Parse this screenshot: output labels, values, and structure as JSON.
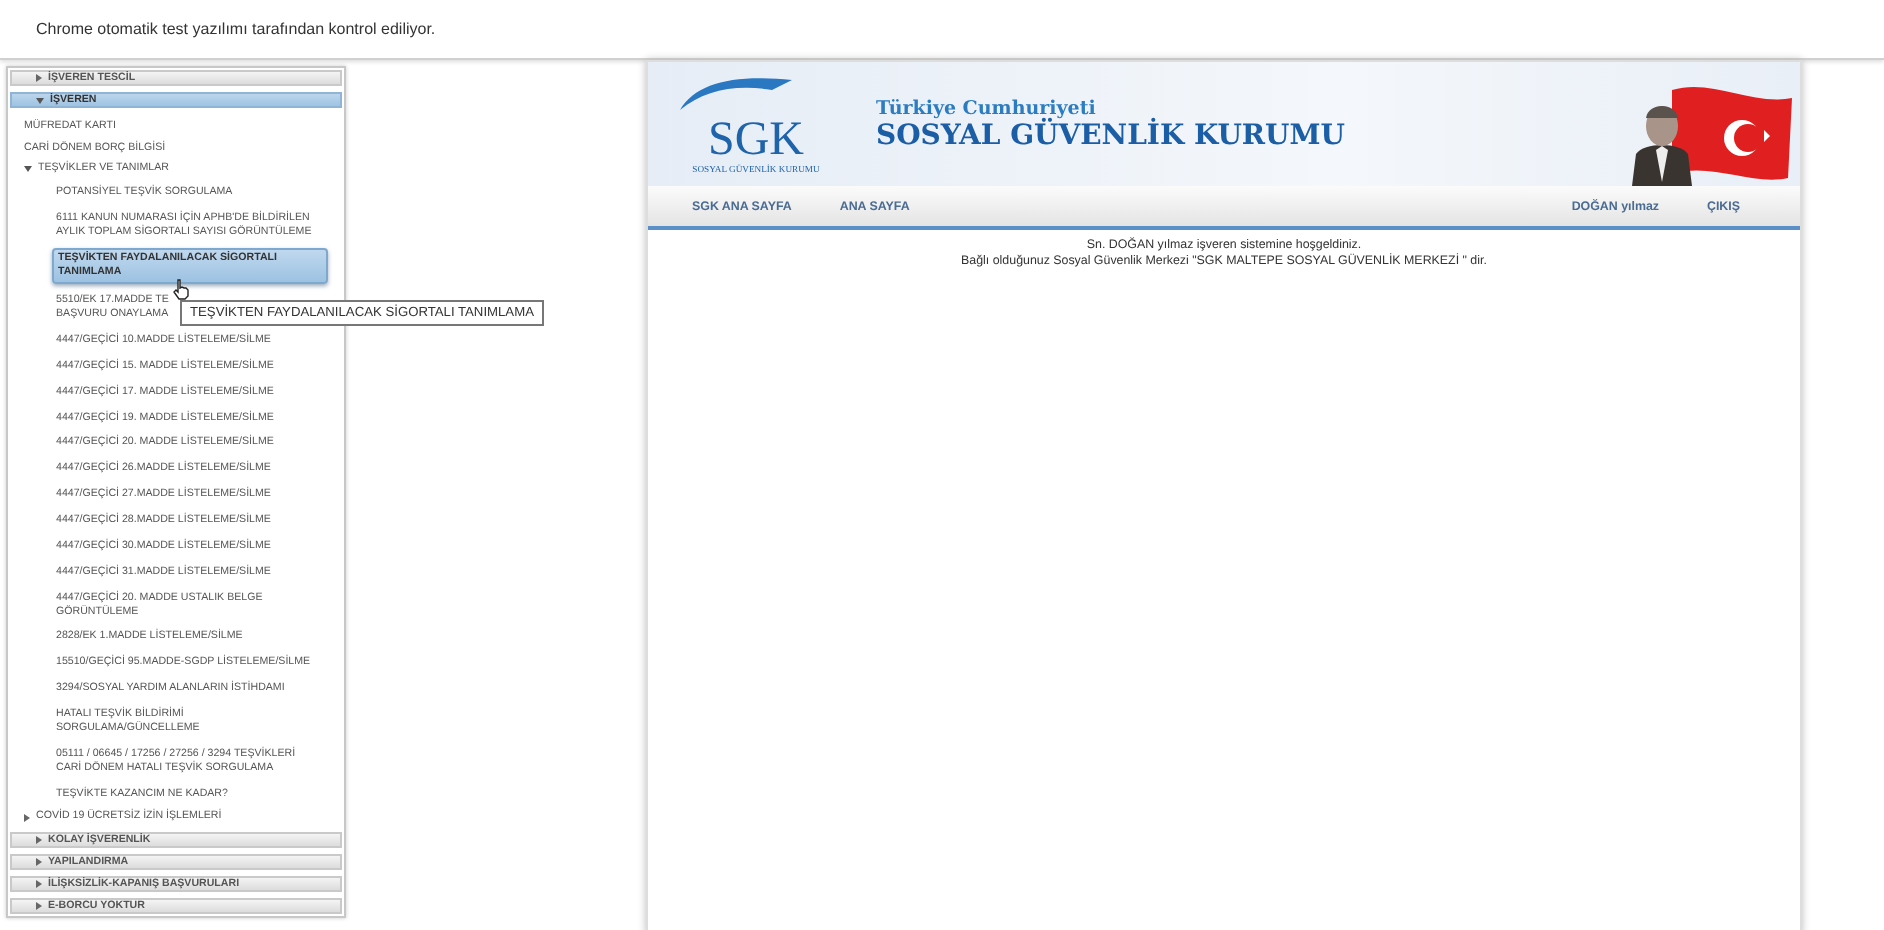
{
  "banner": "Chrome otomatik test yazılımı tarafından kontrol ediliyor.",
  "sidebar": {
    "panels": [
      {
        "title": "İŞVEREN TESCİL",
        "expanded": false
      },
      {
        "title": "İŞVEREN",
        "expanded": true,
        "items": [
          {
            "kind": "link",
            "label": "MÜFREDAT KARTI",
            "selected": false
          },
          {
            "kind": "link",
            "label": "CARİ DÖNEM BORÇ BİLGİSİ",
            "selected": false
          },
          {
            "kind": "folder",
            "label": "TEŞVİKLER VE TANIMLAR",
            "expanded": true,
            "selected": false,
            "children": [
              {
                "label": "POTANSİYEL TEŞVİK SORGULAMA",
                "selected": false
              },
              {
                "label": "6111 KANUN NUMARASI İÇİN APHB'DE BİLDİRİLEN AYLIK TOPLAM SİGORTALI SAYISI GÖRÜNTÜLEME",
                "selected": false
              },
              {
                "label": "TEŞVİKTEN FAYDALANILACAK SİGORTALI TANIMLAMA",
                "selected": true
              },
              {
                "label": "5510/EK 17.MADDE TE\nBAŞVURU ONAYLAMA",
                "selected": false
              },
              {
                "label": "4447/GEÇİCİ 10.MADDE LİSTELEME/SİLME",
                "selected": false
              },
              {
                "label": "4447/GEÇİCİ 15. MADDE LİSTELEME/SİLME",
                "selected": false
              },
              {
                "label": "4447/GEÇİCİ 17. MADDE LİSTELEME/SİLME",
                "selected": false
              },
              {
                "label": "4447/GEÇİCİ 19. MADDE LİSTELEME/SİLME",
                "selected": false
              },
              {
                "label": "4447/GEÇİCİ 20. MADDE LİSTELEME/SİLME",
                "selected": false
              },
              {
                "label": "4447/GEÇİCİ 26.MADDE LİSTELEME/SİLME",
                "selected": false
              },
              {
                "label": "4447/GEÇİCİ 27.MADDE LİSTELEME/SİLME",
                "selected": false
              },
              {
                "label": "4447/GEÇİCİ 28.MADDE LİSTELEME/SİLME",
                "selected": false
              },
              {
                "label": "4447/GEÇİCİ 30.MADDE LİSTELEME/SİLME",
                "selected": false
              },
              {
                "label": "4447/GEÇİCİ 31.MADDE LİSTELEME/SİLME",
                "selected": false
              },
              {
                "label": "4447/GEÇİCİ 20. MADDE USTALIK BELGE GÖRÜNTÜLEME",
                "selected": false
              },
              {
                "label": "2828/EK 1.MADDE LİSTELEME/SİLME",
                "selected": false
              },
              {
                "label": "15510/GEÇİCİ 95.MADDE-SGDP LİSTELEME/SİLME",
                "selected": false
              },
              {
                "label": "3294/SOSYAL YARDIM ALANLARIN İSTİHDAMI",
                "selected": false
              },
              {
                "label": "HATALI TEŞVİK BİLDİRİMİ SORGULAMA/GÜNCELLEME",
                "selected": false
              },
              {
                "label": "05111 / 06645 / 17256 / 27256 / 3294 TEŞVİKLERİ CARİ DÖNEM HATALI TEŞVİK SORGULAMA",
                "selected": false
              },
              {
                "label": "TEŞVİKTE KAZANCIM NE KADAR?",
                "selected": false
              }
            ]
          },
          {
            "kind": "folder",
            "label": "COVİD 19 ÜCRETSİZ İZİN İŞLEMLERİ",
            "expanded": false,
            "selected": false
          }
        ]
      },
      {
        "title": "KOLAY İŞVERENLİK",
        "expanded": false
      },
      {
        "title": "YAPILANDIRMA",
        "expanded": false
      },
      {
        "title": "İLİŞKSİZLİK-KAPANIŞ BAŞVURULARI",
        "expanded": false
      },
      {
        "title": "E-BORCU YOKTUR",
        "expanded": false
      }
    ]
  },
  "tooltip": "TEŞVİKTEN FAYDALANILACAK SİGORTALI TANIMLAMA",
  "header": {
    "logo": "SGK",
    "logo_subtitle": "SOSYAL GÜVENLİK KURUMU",
    "subtitle": "Türkiye Cumhuriyeti",
    "title": "SOSYAL GÜVENLİK KURUMU"
  },
  "nav": {
    "left": [
      "SGK ANA SAYFA",
      "ANA SAYFA"
    ],
    "right": [
      "DOĞAN yılmaz",
      "ÇIKIŞ"
    ]
  },
  "welcome": [
    "Sn. DOĞAN yılmaz işveren sistemine hoşgeldiniz.",
    "Bağlı olduğunuz Sosyal Güvenlik Merkezi \"SGK MALTEPE SOSYAL GÜVENLİK MERKEZİ \" dir."
  ]
}
